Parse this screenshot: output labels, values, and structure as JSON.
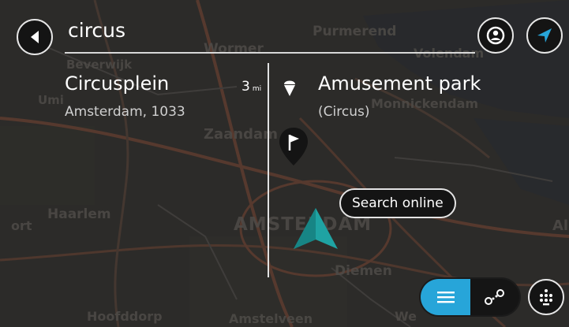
{
  "search": {
    "query": "circus"
  },
  "results": [
    {
      "title": "Circusplein",
      "subtitle": "Amsterdam, 1033",
      "distance": "3",
      "distance_unit": "mi"
    },
    {
      "title": "Amusement park",
      "subtitle": "(Circus)",
      "icon": "ice-cream-icon"
    }
  ],
  "search_online": {
    "label": "Search online"
  },
  "map_labels": {
    "top_center": "Wormer",
    "purmerend": "Purmerend",
    "volendam": "Volendam",
    "beverwijk": "Beverwijk",
    "uitgeest": "Umi",
    "monnickendam": "Monnickendam",
    "zaandam": "Zaandam",
    "haarlem": "Haarlem",
    "left_edge": "ort",
    "amsterdam": "AMSTERDAM",
    "right_edge": "Al",
    "diemen": "Diemen",
    "hoofddorp": "Hoofddorp",
    "amstelveen": "Amstelveen",
    "weesp": "We"
  },
  "colors": {
    "accent": "#27a5d9",
    "position_marker": "#1fa3a3",
    "button_bg": "#141414"
  },
  "icons": {
    "back": "back-arrow-icon",
    "location_pin": "location-pin-icon",
    "navigate": "navigate-arrow-icon",
    "list": "list-icon",
    "route": "route-icon",
    "keyboard": "keyboard-icon",
    "flag": "flag-pin-icon",
    "current_position": "current-position-arrow-icon"
  }
}
